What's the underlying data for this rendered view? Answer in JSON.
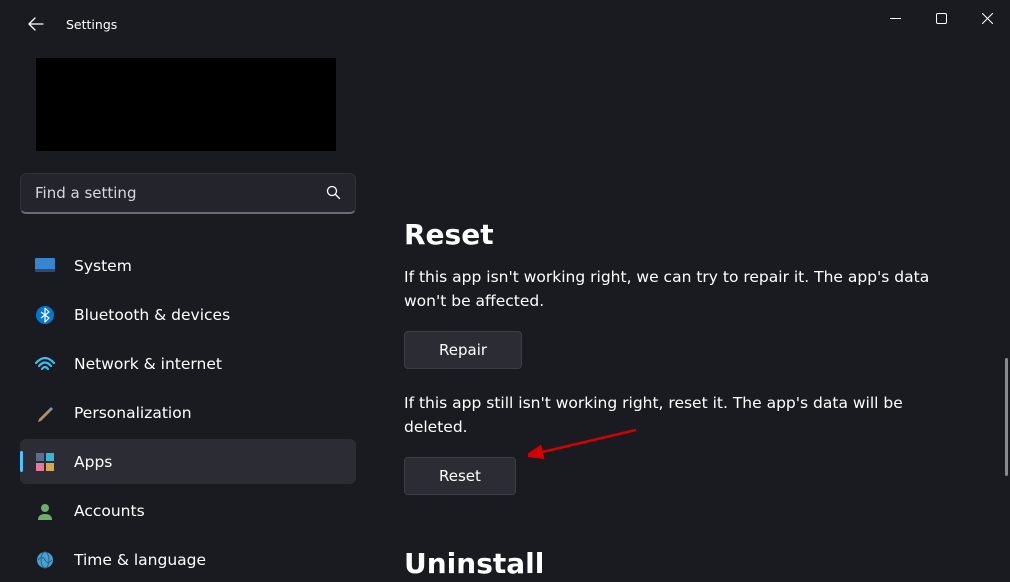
{
  "header": {
    "title": "Settings"
  },
  "search": {
    "placeholder": "Find a setting"
  },
  "sidebar": {
    "items": [
      {
        "label": "System",
        "icon": "system"
      },
      {
        "label": "Bluetooth & devices",
        "icon": "bluetooth"
      },
      {
        "label": "Network & internet",
        "icon": "network"
      },
      {
        "label": "Personalization",
        "icon": "personalization"
      },
      {
        "label": "Apps",
        "icon": "apps"
      },
      {
        "label": "Accounts",
        "icon": "accounts"
      },
      {
        "label": "Time & language",
        "icon": "time"
      }
    ],
    "activeIndex": 4
  },
  "content": {
    "reset": {
      "title": "Reset",
      "repairDesc": "If this app isn't working right, we can try to repair it. The app's data won't be affected.",
      "repairButton": "Repair",
      "resetDesc": "If this app still isn't working right, reset it. The app's data will be deleted.",
      "resetButton": "Reset"
    },
    "uninstall": {
      "title": "Uninstall"
    }
  },
  "annotation": {
    "target": "reset-button"
  }
}
